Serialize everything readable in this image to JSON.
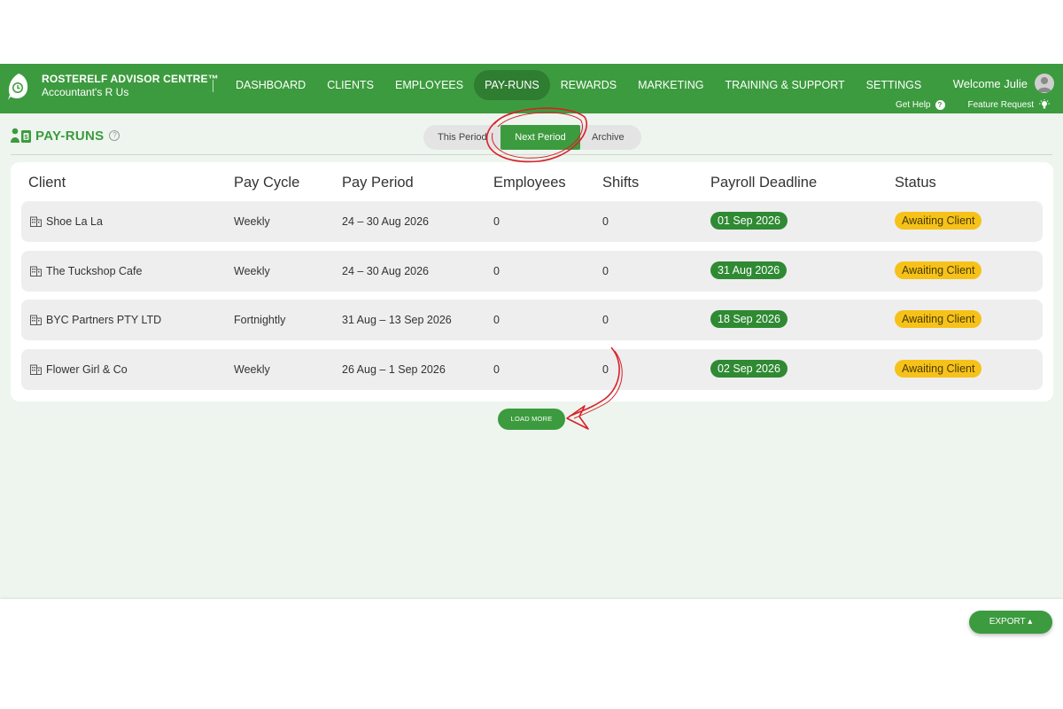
{
  "header": {
    "brand_title": "ROSTERELF ADVISOR CENTRE™",
    "brand_subtitle": "Accountant's R Us",
    "nav": [
      {
        "label": "DASHBOARD",
        "active": false
      },
      {
        "label": "CLIENTS",
        "active": false
      },
      {
        "label": "EMPLOYEES",
        "active": false
      },
      {
        "label": "PAY-RUNS",
        "active": true
      },
      {
        "label": "REWARDS",
        "active": false
      },
      {
        "label": "MARKETING",
        "active": false
      },
      {
        "label": "TRAINING & SUPPORT",
        "active": false
      },
      {
        "label": "SETTINGS",
        "active": false
      }
    ],
    "welcome": "Welcome Julie",
    "get_help": "Get Help",
    "feature_request": "Feature Request"
  },
  "page": {
    "title": "PAY-RUNS",
    "tabs": [
      {
        "label": "This Period",
        "active": false
      },
      {
        "label": "Next Period",
        "active": true
      },
      {
        "label": "Archive",
        "active": false
      }
    ]
  },
  "table": {
    "columns": [
      "Client",
      "Pay Cycle",
      "Pay Period",
      "Employees",
      "Shifts",
      "Payroll Deadline",
      "Status"
    ],
    "rows": [
      {
        "client": "Shoe La La",
        "pay_cycle": "Weekly",
        "pay_period": "24 – 30 Aug 2026",
        "employees": "0",
        "shifts": "0",
        "deadline": "01 Sep 2026",
        "status": "Awaiting Client"
      },
      {
        "client": "The Tuckshop Cafe",
        "pay_cycle": "Weekly",
        "pay_period": "24 – 30 Aug 2026",
        "employees": "0",
        "shifts": "0",
        "deadline": "31 Aug 2026",
        "status": "Awaiting Client"
      },
      {
        "client": "BYC Partners PTY LTD",
        "pay_cycle": "Fortnightly",
        "pay_period": "31 Aug – 13 Sep 2026",
        "employees": "0",
        "shifts": "0",
        "deadline": "18 Sep 2026",
        "status": "Awaiting Client"
      },
      {
        "client": "Flower Girl & Co",
        "pay_cycle": "Weekly",
        "pay_period": "26 Aug – 1 Sep 2026",
        "employees": "0",
        "shifts": "0",
        "deadline": "02 Sep 2026",
        "status": "Awaiting Client"
      }
    ]
  },
  "actions": {
    "load_more": "LOAD MORE",
    "export": "EXPORT ▴"
  },
  "colors": {
    "brand_green": "#3c9b3e",
    "active_nav": "#2f7d31",
    "deadline_pill": "#2f8a33",
    "status_pill": "#f6c21a",
    "annotation_red": "#d8202a"
  }
}
